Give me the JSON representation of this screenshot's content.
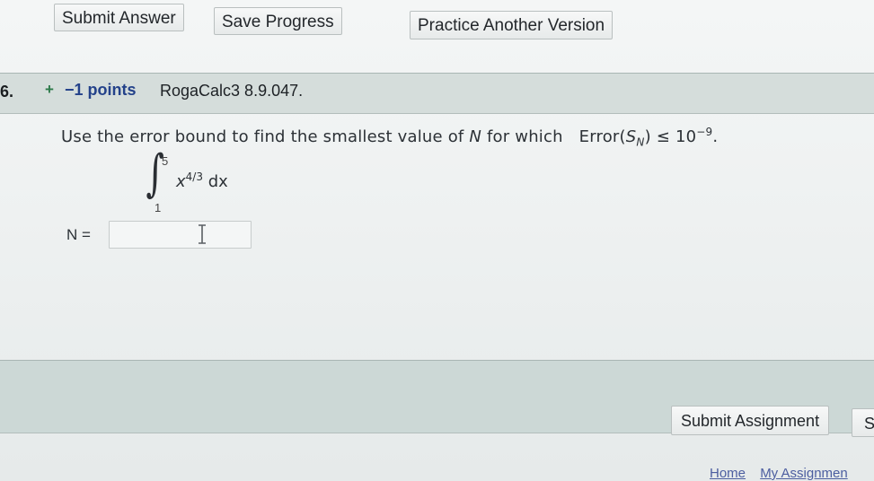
{
  "toolbar": {
    "submit_answer": "Submit Answer",
    "save_progress": "Save Progress",
    "practice_another": "Practice Another Version"
  },
  "question": {
    "number_fragment": "6.",
    "points": "−1 points",
    "source": "RogaCalc3 8.9.047.",
    "prompt_text": "Use the error bound to find the smallest value of",
    "prompt_var": "N",
    "prompt_for_which": "for which",
    "error_label": "Error(",
    "error_s": "S",
    "error_sub": "N",
    "error_close": ")",
    "leq": "≤",
    "ten": "10",
    "exponent": "−9",
    "period": ".",
    "integral": {
      "upper": "5",
      "lower": "1",
      "base": "x",
      "power": "4/3",
      "differential": "dx"
    },
    "answer_label": "N =",
    "answer_value": ""
  },
  "footer": {
    "submit_assignment": "Submit Assignment",
    "next_partial": "S",
    "nav": [
      "Home",
      "My Assignmen"
    ]
  },
  "icons": {
    "plus": "plus-icon",
    "text_cursor": "text-cursor-icon"
  },
  "colors": {
    "header_band": "#d5dddb",
    "points_blue": "#24428a",
    "plus_green": "#2d7a4a",
    "link_blue": "#4c5ea0"
  }
}
